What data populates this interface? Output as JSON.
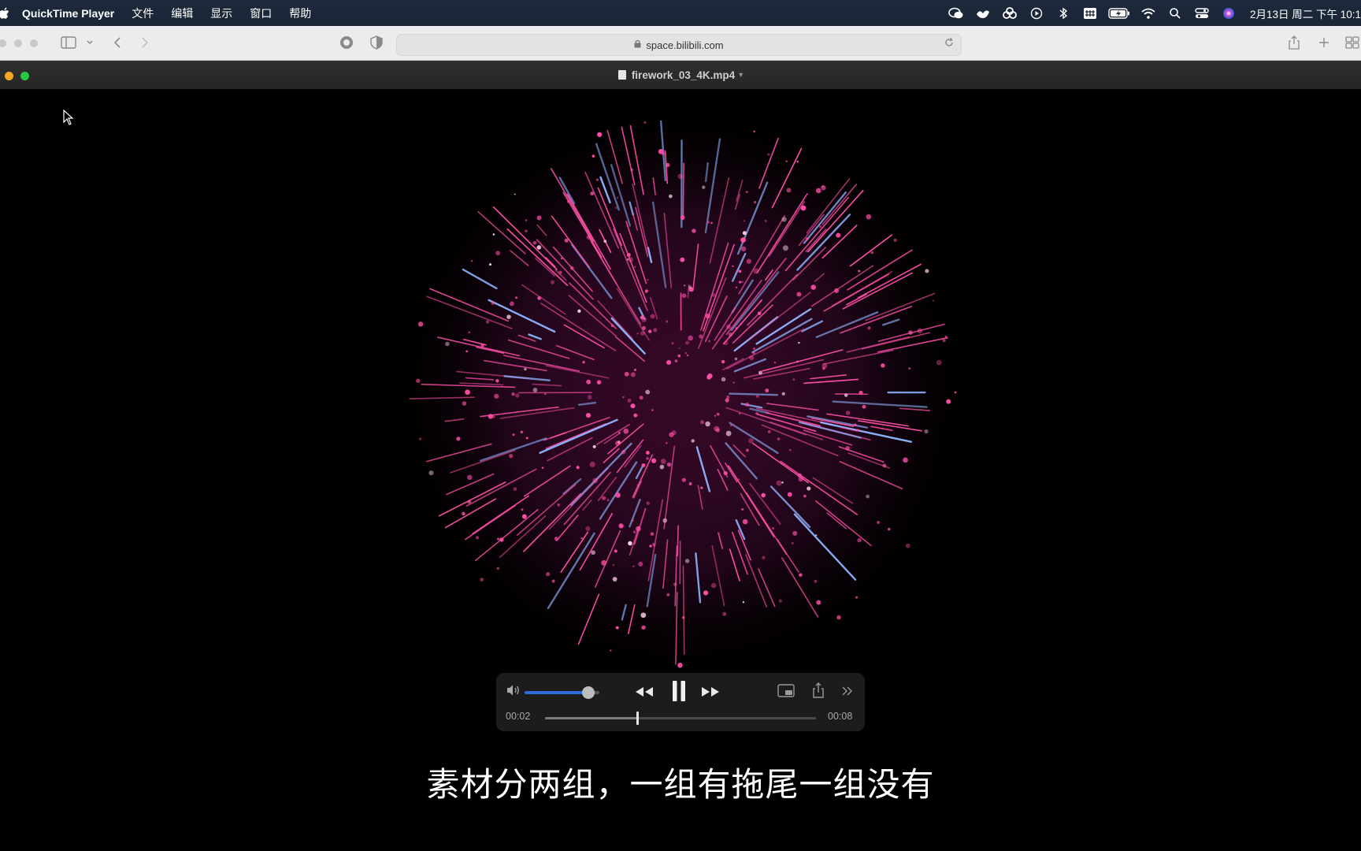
{
  "menubar": {
    "app_name": "QuickTime Player",
    "menus": [
      "文件",
      "编辑",
      "显示",
      "窗口",
      "帮助"
    ],
    "status_icons": [
      "wechat-icon",
      "bird-icon",
      "link-icon",
      "play-circle-icon",
      "bluetooth-icon",
      "input-method-icon",
      "battery-icon",
      "wifi-icon",
      "search-icon",
      "control-center-icon",
      "siri-icon"
    ],
    "clock": "2月13日 周二 下午 10:1"
  },
  "browser": {
    "url": "space.bilibili.com"
  },
  "player": {
    "title": "firework_03_4K.mp4",
    "current_time": "00:02",
    "duration": "00:08",
    "volume_fraction": 0.85,
    "progress_fraction": 0.34,
    "state": "playing"
  },
  "subtitle": "素材分两组，一组有拖尾一组没有",
  "colors": {
    "firework_pink": "#ff4fa8",
    "firework_blue": "#8fb4ff",
    "volume_accent": "#2f6bd8"
  }
}
